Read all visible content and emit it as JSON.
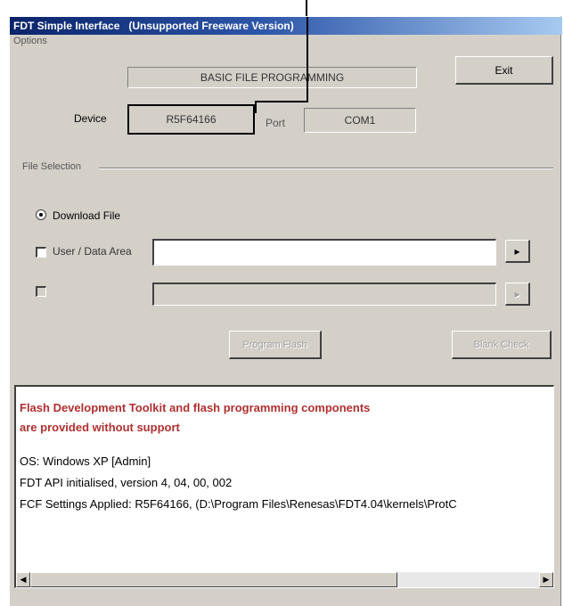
{
  "window": {
    "title": "FDT Simple Interface   (Unsupported Freeware Version)",
    "menu": "Options"
  },
  "header": {
    "mode_label": "BASIC FILE PROGRAMMING",
    "exit_label": "Exit"
  },
  "device": {
    "label": "Device",
    "value": "R5F64166",
    "port_label": "Port",
    "port_value": "COM1"
  },
  "file_selection": {
    "group_label": "File Selection",
    "download_label": "Download File",
    "user_area_label": "User / Data Area",
    "user_area_value": "",
    "second_label": "",
    "browse_glyph": "▸"
  },
  "actions": {
    "program_label": "Program Flash",
    "second_label": "Blank Check"
  },
  "log": {
    "lines": [
      "Flash Development Toolkit and flash programming components",
      "are provided without support",
      "",
      "OS: Windows XP [Admin]",
      "FDT API initialised, version 4, 04, 00, 002",
      "FCF Settings Applied: R5F64166, (D:\\Program Files\\Renesas\\FDT4.04\\kernels\\ProtC"
    ]
  },
  "colors": {
    "title_start": "#0a246a",
    "title_end": "#a6caf0",
    "face": "#d4d0c8",
    "warning_text": "#b03030"
  }
}
